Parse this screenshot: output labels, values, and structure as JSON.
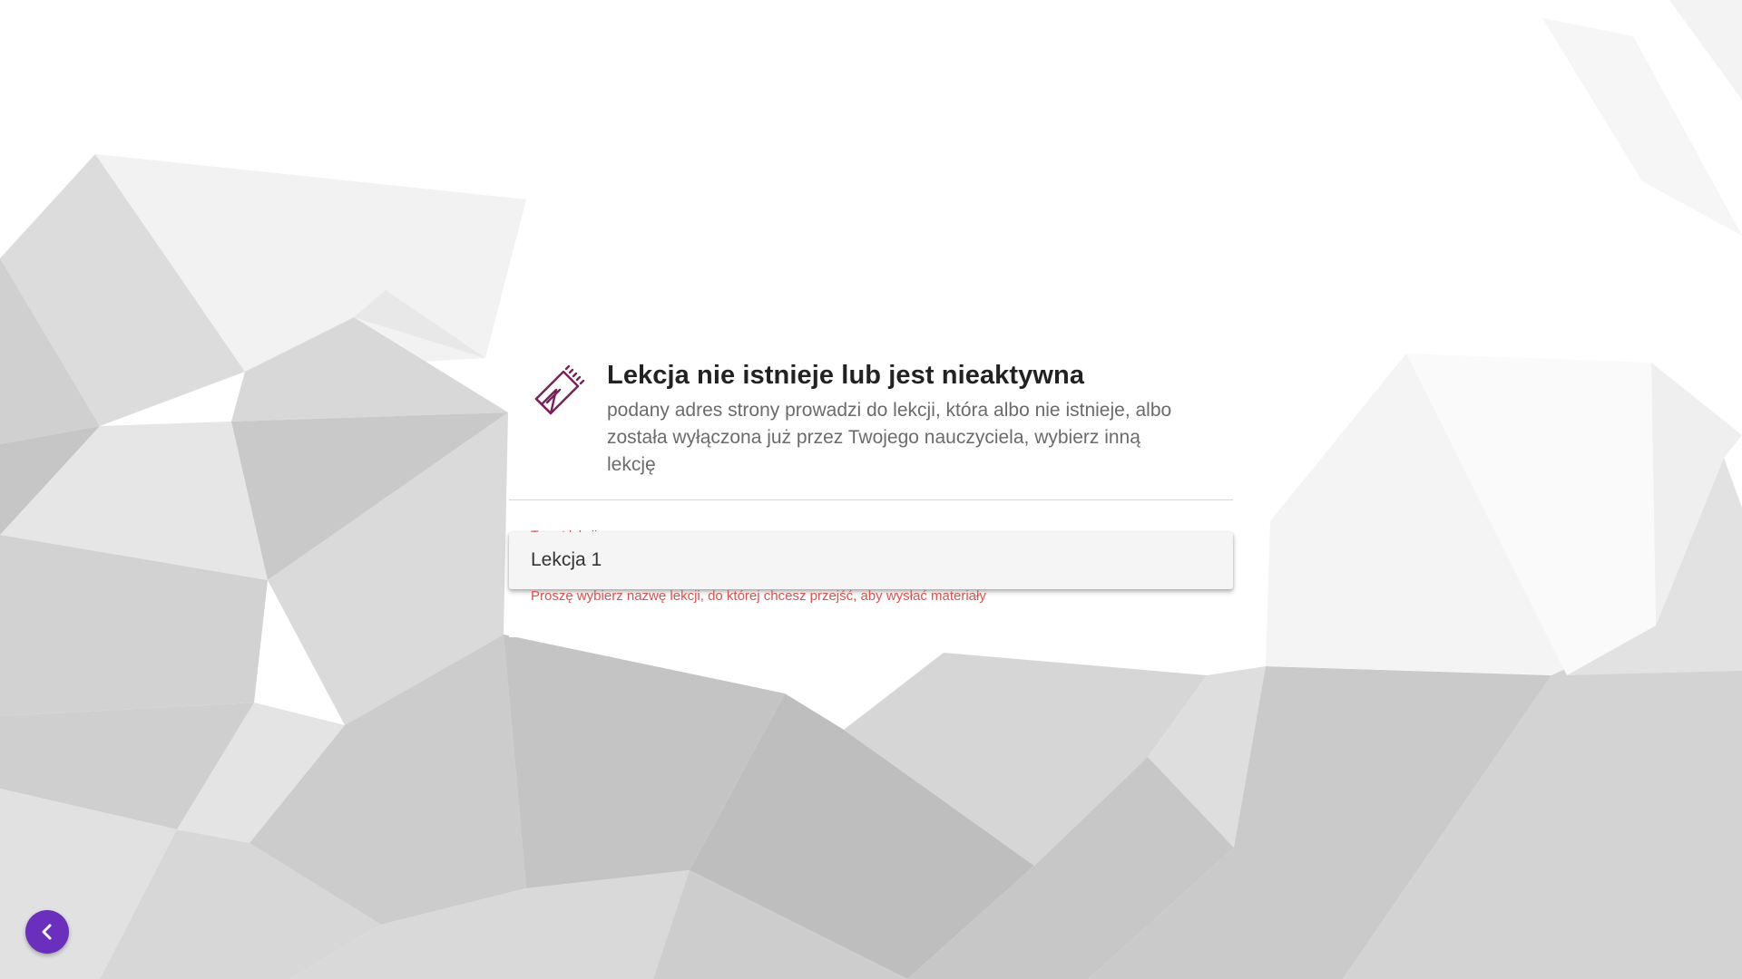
{
  "colors": {
    "accent": "#6a2fbd",
    "icon": "#7a1f5c",
    "error": "#d9534f"
  },
  "card": {
    "icon": "notebook-pen-icon",
    "title": "Lekcja nie istnieje lub jest nieaktywna",
    "description": "podany adres strony prowadzi do lekcji, która albo nie istnieje, albo została wyłączona już przez Twojego nauczyciela, wybierz inną lekcję"
  },
  "lesson_field": {
    "label": "Temat lekcji",
    "options": [
      "Lekcja 1"
    ],
    "error": "Proszę wybierz nazwę lekcji, do której chcesz przejść, aby wysłać materiały"
  },
  "back_button": {
    "icon": "chevron-left-icon"
  }
}
